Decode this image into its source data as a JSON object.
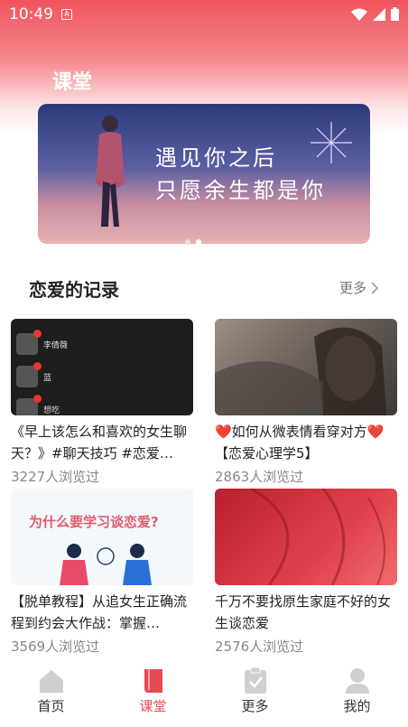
{
  "status": {
    "time": "10:49"
  },
  "page": {
    "title": "课堂"
  },
  "banner": {
    "line1": "遇见你之后",
    "line2": "只愿余生都是你"
  },
  "section": {
    "title": "恋爱的记录",
    "more": "更多"
  },
  "cards": [
    {
      "title": "《早上该怎么和喜欢的女生聊天？》#聊天技巧 #恋爱…",
      "views": "3227人浏览过"
    },
    {
      "title": "❤️如何从微表情看穿对方❤️【恋爱心理学5】",
      "views": "2863人浏览过"
    },
    {
      "title": "【脱单教程】从追女生正确流程到约会大作战：掌握…",
      "views": "3569人浏览过"
    },
    {
      "title": "千万不要找原生家庭不好的女生谈恋爱",
      "views": "2576人浏览过"
    }
  ],
  "thumb1": {
    "names": [
      "李倩薇",
      "蓝",
      "想吃"
    ]
  },
  "thumb3": {
    "question": "为什么要学习谈恋爱?"
  },
  "tabs": [
    {
      "label": "首页",
      "icon": "home-icon"
    },
    {
      "label": "课堂",
      "icon": "book-icon"
    },
    {
      "label": "更多",
      "icon": "clipboard-check-icon"
    },
    {
      "label": "我的",
      "icon": "user-icon"
    }
  ],
  "colors": {
    "accent": "#e84a55",
    "header": "#f0535c"
  }
}
